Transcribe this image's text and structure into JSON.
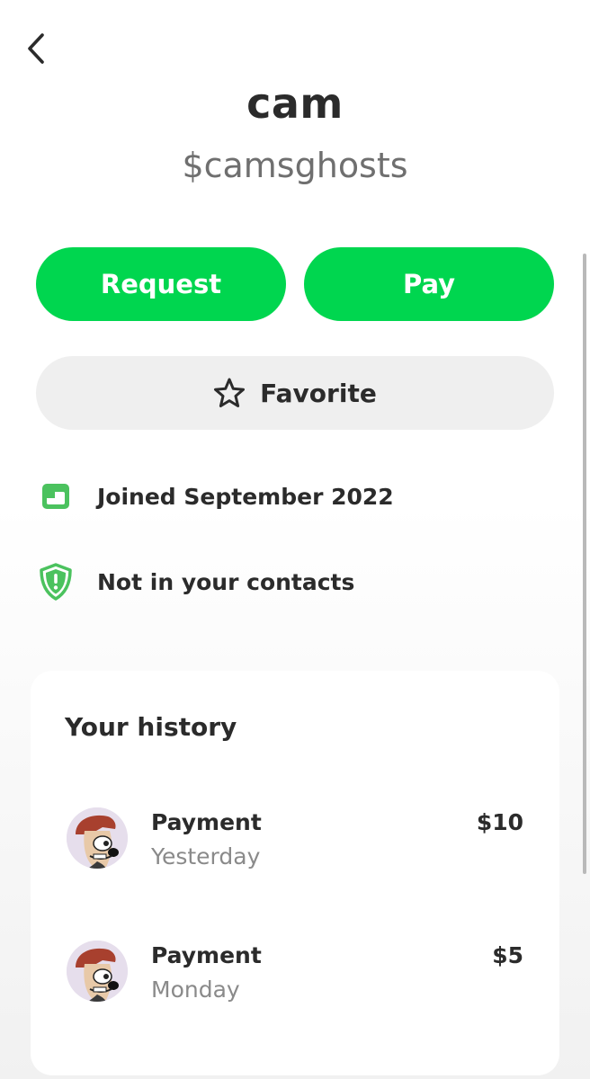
{
  "profile": {
    "name": "cam",
    "cashtag": "$camsghosts"
  },
  "actions": {
    "request_label": "Request",
    "pay_label": "Pay",
    "favorite_label": "Favorite"
  },
  "info": {
    "joined": "Joined September 2022",
    "contacts": "Not in your contacts"
  },
  "history": {
    "title": "Your history",
    "items": [
      {
        "title": "Payment",
        "date": "Yesterday",
        "amount": "$10",
        "avatar_icon": "cartoon-avatar"
      },
      {
        "title": "Payment",
        "date": "Monday",
        "amount": "$5",
        "avatar_icon": "cartoon-avatar"
      }
    ]
  },
  "colors": {
    "accent": "#00d64f",
    "icon_green": "#4bc25e",
    "text_primary": "#2b2b2b",
    "text_secondary": "#8a8a8a"
  }
}
